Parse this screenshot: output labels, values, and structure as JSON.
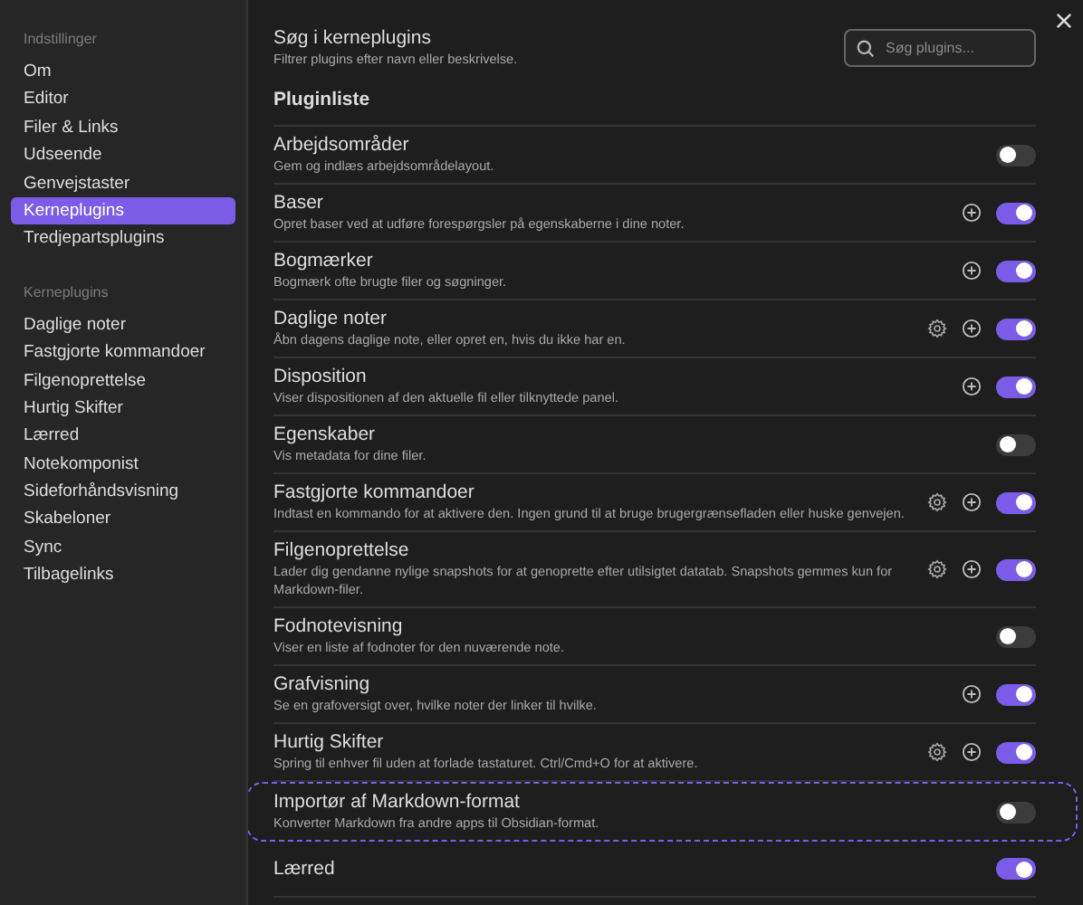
{
  "sidebar": {
    "sections": [
      {
        "heading": "Indstillinger",
        "items": [
          {
            "label": "Om",
            "selected": false
          },
          {
            "label": "Editor",
            "selected": false
          },
          {
            "label": "Filer & Links",
            "selected": false
          },
          {
            "label": "Udseende",
            "selected": false
          },
          {
            "label": "Genvejstaster",
            "selected": false
          },
          {
            "label": "Kerneplugins",
            "selected": true
          },
          {
            "label": "Tredjepartsplugins",
            "selected": false
          }
        ]
      },
      {
        "heading": "Kerneplugins",
        "items": [
          {
            "label": "Daglige noter",
            "selected": false
          },
          {
            "label": "Fastgjorte kommandoer",
            "selected": false
          },
          {
            "label": "Filgenoprettelse",
            "selected": false
          },
          {
            "label": "Hurtig Skifter",
            "selected": false
          },
          {
            "label": "Lærred",
            "selected": false
          },
          {
            "label": "Notekomponist",
            "selected": false
          },
          {
            "label": "Sideforhåndsvisning",
            "selected": false
          },
          {
            "label": "Skabeloner",
            "selected": false
          },
          {
            "label": "Sync",
            "selected": false
          },
          {
            "label": "Tilbagelinks",
            "selected": false
          }
        ]
      }
    ]
  },
  "search": {
    "title": "Søg i kerneplugins",
    "description": "Filtrer plugins efter navn eller beskrivelse.",
    "placeholder": "Søg plugins..."
  },
  "plugin_list": {
    "heading": "Pluginliste",
    "plugins": [
      {
        "name": "Arbejdsområder",
        "description": "Gem og indlæs arbejdsområdelayout.",
        "settings": false,
        "add": false,
        "enabled": false,
        "highlighted": false
      },
      {
        "name": "Baser",
        "description": "Opret baser ved at udføre forespørgsler på egenskaberne i dine noter.",
        "settings": false,
        "add": true,
        "enabled": true,
        "highlighted": false
      },
      {
        "name": "Bogmærker",
        "description": "Bogmærk ofte brugte filer og søgninger.",
        "settings": false,
        "add": true,
        "enabled": true,
        "highlighted": false
      },
      {
        "name": "Daglige noter",
        "description": "Åbn dagens daglige note, eller opret en, hvis du ikke har en.",
        "settings": true,
        "add": true,
        "enabled": true,
        "highlighted": false
      },
      {
        "name": "Disposition",
        "description": "Viser dispositionen af den aktuelle fil eller tilknyttede panel.",
        "settings": false,
        "add": true,
        "enabled": true,
        "highlighted": false
      },
      {
        "name": "Egenskaber",
        "description": "Vis metadata for dine filer.",
        "settings": false,
        "add": false,
        "enabled": false,
        "highlighted": false
      },
      {
        "name": "Fastgjorte kommandoer",
        "description": "Indtast en kommando for at aktivere den. Ingen grund til at bruge brugergrænsefladen eller huske genvejen.",
        "settings": true,
        "add": true,
        "enabled": true,
        "highlighted": false
      },
      {
        "name": "Filgenoprettelse",
        "description": "Lader dig gendanne nylige snapshots for at genoprette efter utilsigtet datatab. Snapshots gemmes kun for Markdown-filer.",
        "settings": true,
        "add": true,
        "enabled": true,
        "highlighted": false
      },
      {
        "name": "Fodnotevisning",
        "description": "Viser en liste af fodnoter for den nuværende note.",
        "settings": false,
        "add": false,
        "enabled": false,
        "highlighted": false
      },
      {
        "name": "Grafvisning",
        "description": "Se en grafoversigt over, hvilke noter der linker til hvilke.",
        "settings": false,
        "add": true,
        "enabled": true,
        "highlighted": false
      },
      {
        "name": "Hurtig Skifter",
        "description": "Spring til enhver fil uden at forlade tastaturet. Ctrl/Cmd+O for at aktivere.",
        "settings": true,
        "add": true,
        "enabled": true,
        "highlighted": false
      },
      {
        "name": "Importør af Markdown-format",
        "description": "Konverter Markdown fra andre apps til Obsidian-format.",
        "settings": false,
        "add": false,
        "enabled": false,
        "highlighted": true
      },
      {
        "name": "Lærred",
        "settings": false,
        "add": false,
        "enabled": true,
        "highlighted": false
      }
    ]
  }
}
